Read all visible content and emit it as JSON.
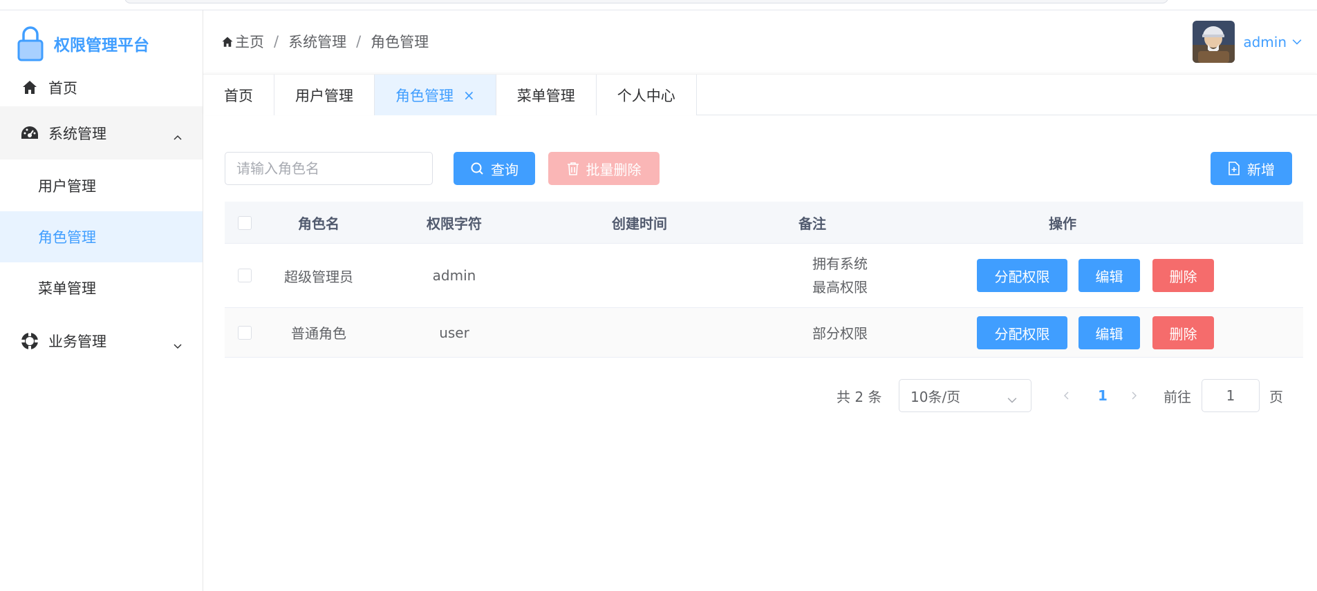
{
  "app": {
    "title": "权限管理平台"
  },
  "sidebar": {
    "items": [
      {
        "label": "首页",
        "icon": "home-icon"
      },
      {
        "label": "系统管理",
        "icon": "dashboard-icon",
        "expanded": true,
        "children": [
          {
            "label": "用户管理"
          },
          {
            "label": "角色管理",
            "active": true
          },
          {
            "label": "菜单管理"
          }
        ]
      },
      {
        "label": "业务管理",
        "icon": "circle-icon",
        "expanded": false
      }
    ]
  },
  "header": {
    "breadcrumb": [
      "主页",
      "系统管理",
      "角色管理"
    ],
    "username": "admin"
  },
  "tabs": [
    {
      "label": "首页"
    },
    {
      "label": "用户管理"
    },
    {
      "label": "角色管理",
      "active": true,
      "close": "×"
    },
    {
      "label": "菜单管理"
    },
    {
      "label": "个人中心"
    }
  ],
  "toolbar": {
    "search_placeholder": "请输入角色名",
    "search_value": "",
    "query_label": "查询",
    "batch_delete_label": "批量删除",
    "add_label": "新增"
  },
  "table": {
    "columns": [
      "角色名",
      "权限字符",
      "创建时间",
      "备注",
      "操作"
    ],
    "rows": [
      {
        "name": "超级管理员",
        "key": "admin",
        "created": "",
        "remark_line1": "拥有系统",
        "remark_line2": "最高权限"
      },
      {
        "name": "普通角色",
        "key": "user",
        "created": "",
        "remark_line1": "部分权限",
        "remark_line2": ""
      }
    ],
    "actions": {
      "assign": "分配权限",
      "edit": "编辑",
      "delete": "删除"
    }
  },
  "pagination": {
    "total": "共 2 条",
    "page_size": "10条/页",
    "current": "1",
    "goto_label": "前往",
    "goto_value": "1",
    "page_suffix": "页"
  },
  "colors": {
    "primary": "#409eff",
    "danger": "#f56c6c",
    "danger_light": "#fab6b6",
    "active_bg": "#e8f3ff"
  }
}
